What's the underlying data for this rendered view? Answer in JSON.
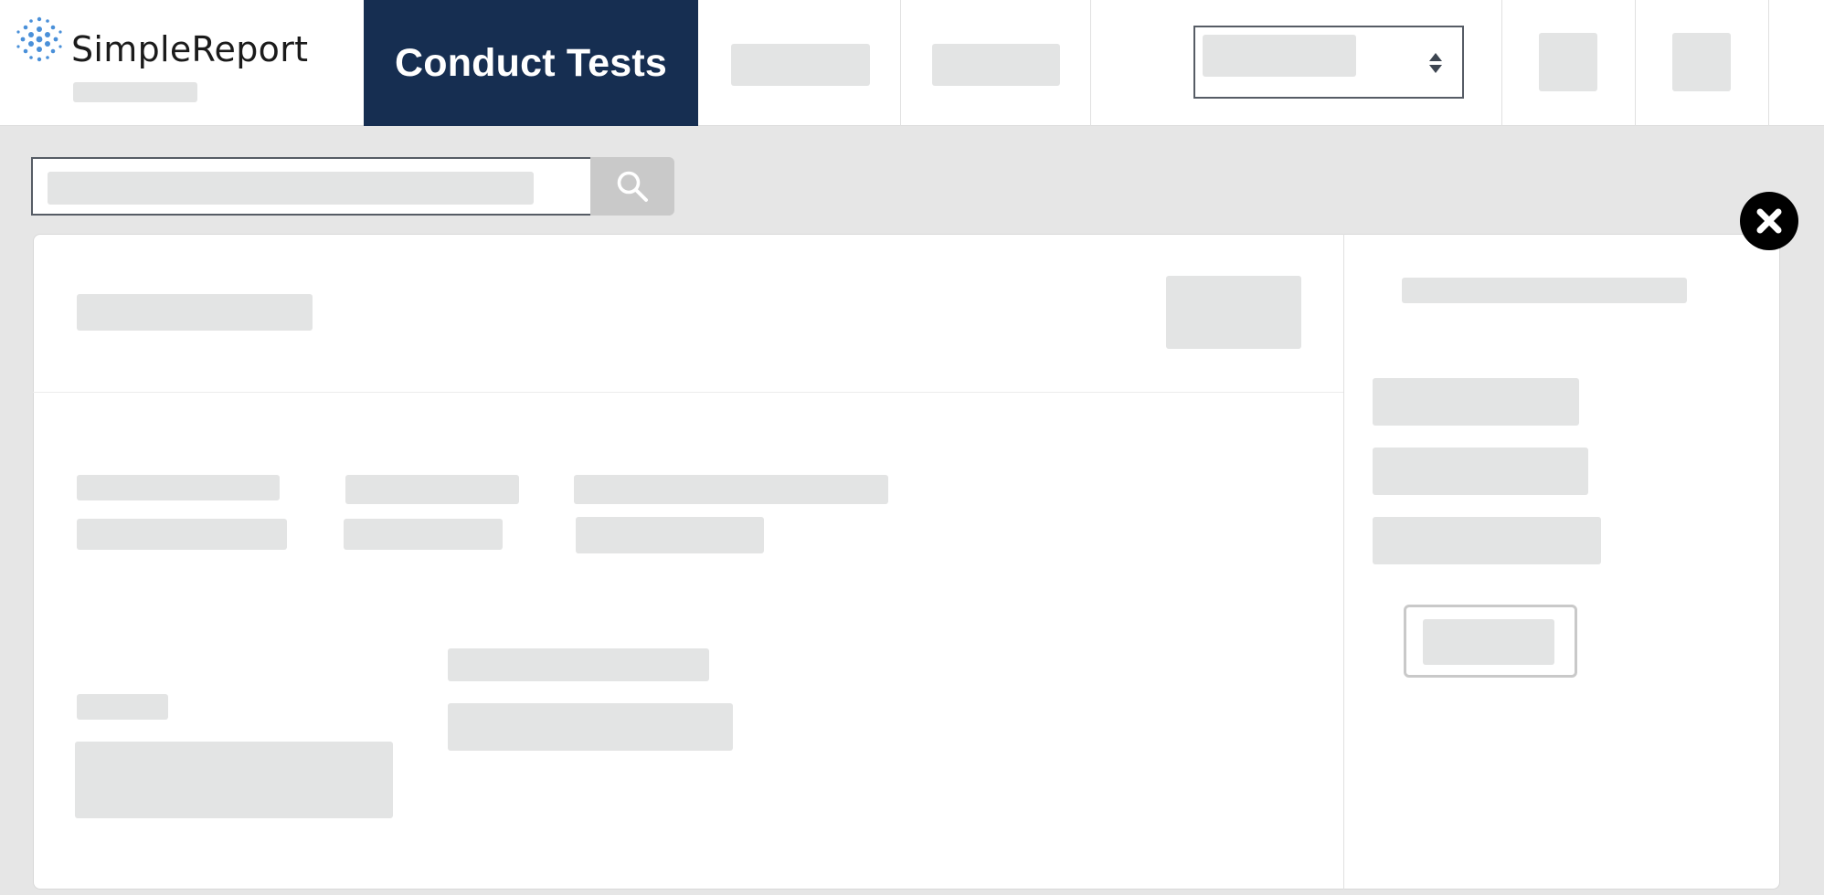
{
  "brand": {
    "name": "SimpleReport",
    "accent_color": "#162e51",
    "logo_dot_color": "#4a90d9"
  },
  "nav": {
    "active_item": "Conduct Tests"
  },
  "icons": {
    "search": "search-icon",
    "close": "close-icon",
    "select_caret": "sort-caret-icon"
  }
}
